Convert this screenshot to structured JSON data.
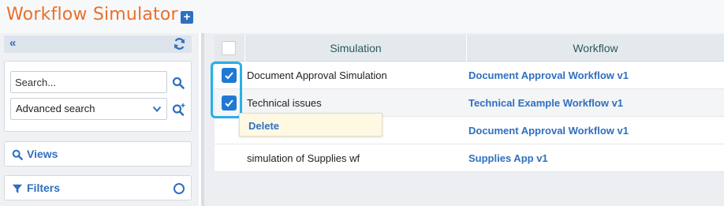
{
  "app": {
    "title": "Workflow Simulator",
    "add_icon": "plus-square-icon"
  },
  "colors": {
    "title": "#e8702a",
    "accent": "#2f6fc0",
    "checkbox": "#1f79d4",
    "highlight": "#2aaee6",
    "tooltip_bg": "#fff9e3"
  },
  "sidebar": {
    "collapse_icon": "double-chevron-left-icon",
    "refresh_icon": "refresh-icon",
    "search": {
      "placeholder": "Search...",
      "value": ""
    },
    "advanced_search": {
      "selected": "Advanced search"
    },
    "views_label": "Views",
    "filters_label": "Filters"
  },
  "grid": {
    "columns": [
      "Simulation",
      "Workflow"
    ],
    "rows": [
      {
        "simulation": "Document Approval Simulation",
        "workflow": "Document Approval Workflow v1",
        "checked": true
      },
      {
        "simulation": "Technical issues",
        "workflow": "Technical Example Workflow v1",
        "checked": true
      },
      {
        "simulation": "",
        "workflow": "Document Approval Workflow v1",
        "checked": false
      },
      {
        "simulation": "simulation of Supplies wf",
        "workflow": "Supplies App v1",
        "checked": false
      }
    ]
  },
  "context_menu": {
    "delete_label": "Delete"
  }
}
